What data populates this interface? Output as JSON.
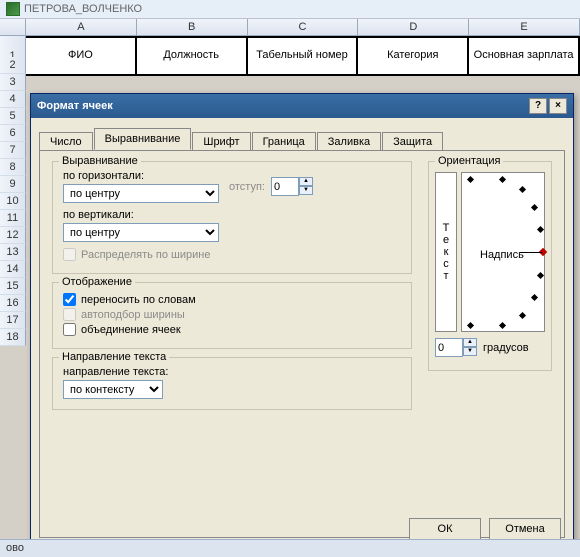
{
  "workbook_title": "ПЕТРОВА_ВОЛЧЕНКО",
  "columns": [
    "A",
    "B",
    "C",
    "D",
    "E"
  ],
  "row1": [
    "ФИО",
    "Должность",
    "Табельный номер",
    "Категория",
    "Основная зарплата"
  ],
  "side_rows": [
    "2",
    "3",
    "4",
    "5",
    "6",
    "7",
    "8",
    "9",
    "10",
    "11",
    "12",
    "13",
    "14",
    "15",
    "16",
    "17",
    "18"
  ],
  "dialog": {
    "title": "Формат ячеек",
    "help": "?",
    "close": "×",
    "tabs": [
      "Число",
      "Выравнивание",
      "Шрифт",
      "Граница",
      "Заливка",
      "Защита"
    ],
    "align_legend": "Выравнивание",
    "hor_label": "по горизонтали:",
    "hor_value": "по центру",
    "indent_label": "отступ:",
    "indent_value": "0",
    "ver_label": "по вертикали:",
    "ver_value": "по центру",
    "distribute": "Распределять по ширине",
    "display_legend": "Отображение",
    "wrap": "переносить по словам",
    "shrink": "автоподбор ширины",
    "merge": "объединение ячеек",
    "dir_legend": "Направление текста",
    "dir_label": "направление текста:",
    "dir_value": "по контексту",
    "orient_legend": "Ориентация",
    "vert_text": [
      "Т",
      "е",
      "к",
      "с",
      "т"
    ],
    "dial_label": "Надпись",
    "deg_value": "0",
    "deg_label": "градусов",
    "ok": "ОК",
    "cancel": "Отмена"
  },
  "status": "ово"
}
